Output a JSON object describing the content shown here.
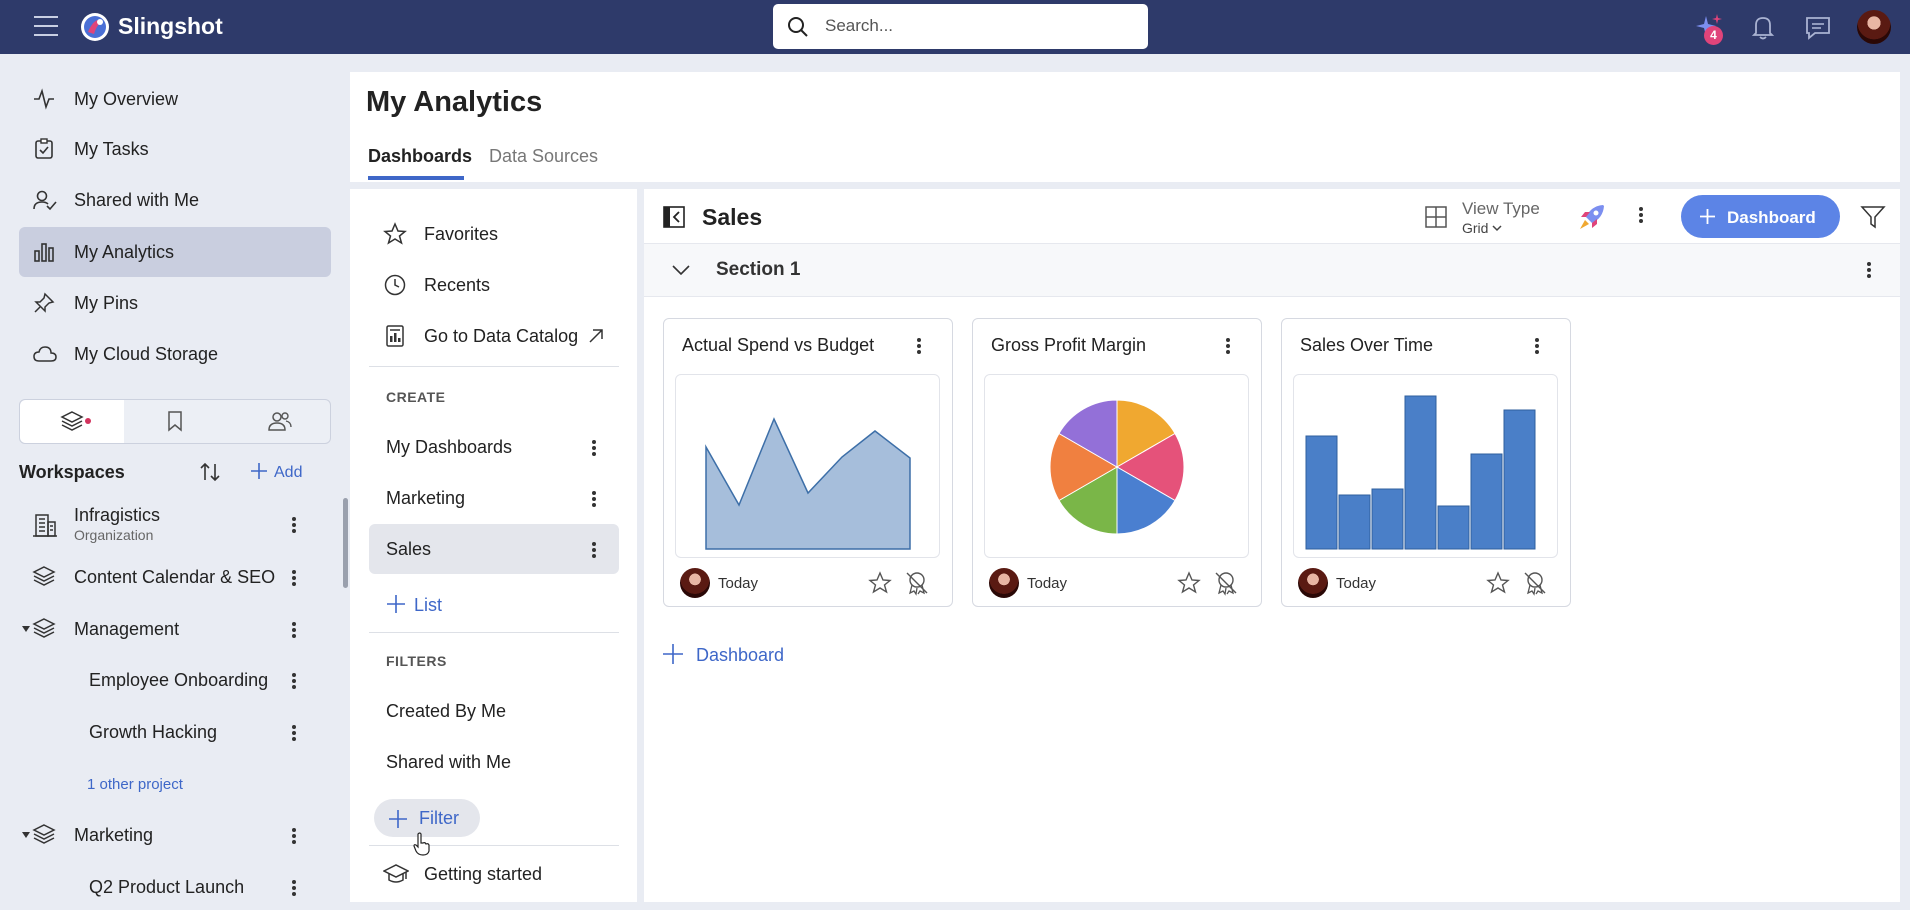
{
  "app": {
    "brand": "Slingshot",
    "notification_count": "4"
  },
  "search": {
    "placeholder": "Search..."
  },
  "nav": [
    {
      "label": "My Overview",
      "icon": "activity-icon"
    },
    {
      "label": "My Tasks",
      "icon": "task-icon"
    },
    {
      "label": "Shared with Me",
      "icon": "user-check-icon"
    },
    {
      "label": "My Analytics",
      "icon": "bar-chart-icon",
      "active": true
    },
    {
      "label": "My Pins",
      "icon": "pin-icon"
    },
    {
      "label": "My Cloud Storage",
      "icon": "cloud-icon"
    }
  ],
  "workspaces": {
    "title": "Workspaces",
    "add_label": "Add",
    "items": [
      {
        "label": "Infragistics",
        "sub": "Organization"
      },
      {
        "label": "Content Calendar & SEO"
      },
      {
        "label": "Management"
      },
      {
        "label": "Employee Onboarding"
      },
      {
        "label": "Growth Hacking"
      },
      {
        "label": "Marketing"
      },
      {
        "label": "Q2 Product Launch"
      }
    ],
    "other_link": "1 other project"
  },
  "page": {
    "title": "My Analytics",
    "tabs": [
      "Dashboards",
      "Data Sources"
    ]
  },
  "folders": {
    "favorites": "Favorites",
    "recents": "Recents",
    "catalog": "Go to Data Catalog",
    "create_header": "CREATE",
    "create_items": [
      "My Dashboards",
      "Marketing",
      "Sales"
    ],
    "list_label": "List",
    "filters_header": "FILTERS",
    "filter_items": [
      "Created By Me",
      "Shared with Me"
    ],
    "filter_button": "Filter",
    "getting_started": "Getting started"
  },
  "content": {
    "title": "Sales",
    "view_type_label": "View Type",
    "view_type_value": "Grid",
    "dashboard_button": "Dashboard",
    "section_title": "Section 1",
    "add_dashboard": "Dashboard",
    "cards": [
      {
        "title": "Actual Spend vs Budget",
        "date": "Today",
        "chart": "area"
      },
      {
        "title": "Gross Profit Margin",
        "date": "Today",
        "chart": "pie"
      },
      {
        "title": "Sales Over Time",
        "date": "Today",
        "chart": "bar"
      }
    ]
  },
  "colors": {
    "topbar": "#2e3a6a",
    "accent": "#3e67c8",
    "button": "#5c84e6",
    "pie": [
      "#f0a830",
      "#e5527a",
      "#4a7fd0",
      "#7ab648",
      "#f08040",
      "#9370d8"
    ]
  }
}
